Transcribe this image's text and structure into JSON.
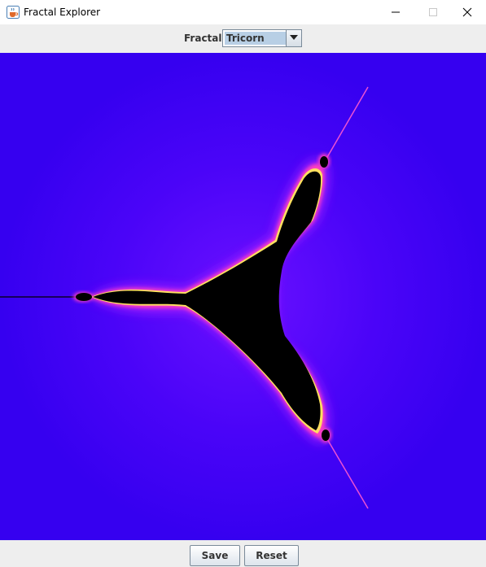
{
  "window": {
    "title": "Fractal Explorer",
    "icons": [
      "java-cup-icon",
      "minimize-icon",
      "maximize-icon",
      "close-icon"
    ]
  },
  "toolbar": {
    "fractal_label": "Fractal:",
    "fractal_selected": "Tricorn"
  },
  "canvas": {
    "fractal": "Tricorn",
    "colors": {
      "background": "#3600f0",
      "set": "#000000",
      "glow": "#ff40c0",
      "edge": "#ffff60"
    }
  },
  "buttons": {
    "save_label": "Save",
    "reset_label": "Reset"
  }
}
